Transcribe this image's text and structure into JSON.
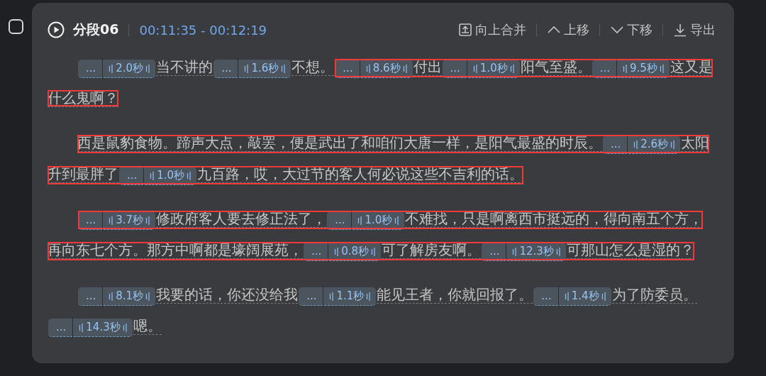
{
  "segment": {
    "checked": false,
    "title": "分段06",
    "time_range": "00:11:35 - 00:12:19",
    "actions": [
      {
        "kind": "merge-up",
        "label": "向上合并"
      },
      {
        "kind": "move-up",
        "label": "上移"
      },
      {
        "kind": "move-down",
        "label": "下移"
      },
      {
        "kind": "export",
        "label": "导出"
      }
    ],
    "paragraphs": [
      {
        "items": [
          {
            "kind": "pause",
            "menu": "...",
            "duration": "2.0秒",
            "boxed": false
          },
          {
            "kind": "text",
            "text": "当不讲的",
            "boxed": false
          },
          {
            "kind": "pause",
            "menu": "...",
            "duration": "1.6秒",
            "boxed": false
          },
          {
            "kind": "text",
            "text": "不想。",
            "boxed": false
          },
          {
            "kind": "pause",
            "menu": "...",
            "duration": "8.6秒",
            "boxed": true
          },
          {
            "kind": "text",
            "text": "付出",
            "boxed": true
          },
          {
            "kind": "pause",
            "menu": "...",
            "duration": "1.0秒",
            "boxed": true
          },
          {
            "kind": "text",
            "text": "阳气至盛。",
            "boxed": true
          },
          {
            "kind": "pause",
            "menu": "...",
            "duration": "9.5秒",
            "boxed": true
          },
          {
            "kind": "text",
            "text": "这又是",
            "boxed": true
          },
          {
            "kind": "text",
            "text": "什么鬼啊？",
            "boxed": true
          }
        ]
      },
      {
        "items": [
          {
            "kind": "text",
            "text": "西是鼠豹食物。蹄声大点，敲罢，便是武出了和咱们大唐一样，是阳气最盛的时辰。",
            "boxed": true
          },
          {
            "kind": "pause",
            "menu": "...",
            "duration": "2.6秒",
            "boxed": true
          },
          {
            "kind": "text",
            "text": "太阳升到最胖了",
            "boxed": true
          },
          {
            "kind": "pause",
            "menu": "...",
            "duration": "1.0秒",
            "boxed": true
          },
          {
            "kind": "text",
            "text": "九百路，哎，大过节的客人何必说这些不吉利的话。",
            "boxed": true
          }
        ]
      },
      {
        "items": [
          {
            "kind": "pause",
            "menu": "...",
            "duration": "3.7秒",
            "boxed": true
          },
          {
            "kind": "text",
            "text": "修政府客人要去修正法了，",
            "boxed": true
          },
          {
            "kind": "pause",
            "menu": "...",
            "duration": "1.0秒",
            "boxed": true
          },
          {
            "kind": "text",
            "text": "不难找，只是啊离西市挺远的，得向南五个方，再向东七个方。那方中啊都是壕阔展苑，",
            "boxed": true
          },
          {
            "kind": "pause",
            "menu": "...",
            "duration": "0.8秒",
            "boxed": true
          },
          {
            "kind": "text",
            "text": "可了解房友啊。",
            "boxed": true
          },
          {
            "kind": "pause",
            "menu": "...",
            "duration": "12.3秒",
            "boxed": true
          },
          {
            "kind": "text",
            "text": "可那山怎么是湿的？",
            "boxed": true
          }
        ]
      },
      {
        "items": [
          {
            "kind": "pause",
            "menu": "...",
            "duration": "8.1秒",
            "boxed": false
          },
          {
            "kind": "text",
            "text": "我要的话，你还没给我",
            "boxed": false
          },
          {
            "kind": "pause",
            "menu": "...",
            "duration": "1.1秒",
            "boxed": false
          },
          {
            "kind": "text",
            "text": "能见王者，你就回报了。",
            "boxed": false
          },
          {
            "kind": "pause",
            "menu": "...",
            "duration": "1.4秒",
            "boxed": false
          },
          {
            "kind": "text",
            "text": "为了防委员。",
            "boxed": false
          },
          {
            "kind": "pause",
            "menu": "...",
            "duration": "14.3秒",
            "boxed": false
          },
          {
            "kind": "text",
            "text": "嗯。",
            "boxed": false
          }
        ]
      }
    ]
  }
}
